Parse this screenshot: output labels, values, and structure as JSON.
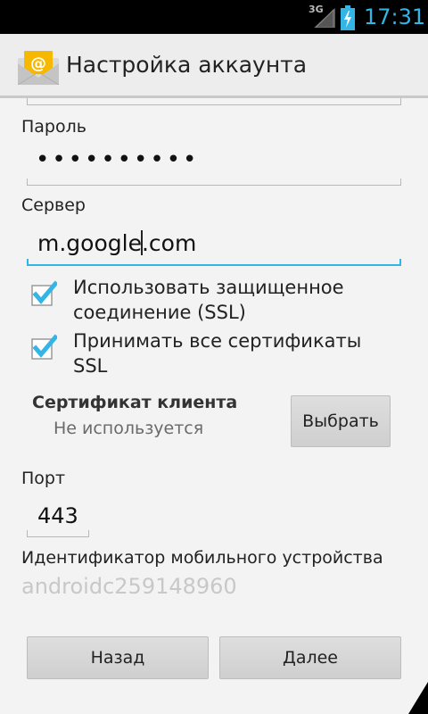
{
  "status_bar": {
    "network": "3G",
    "time": "17:31"
  },
  "action_bar": {
    "title": "Настройка аккаунта",
    "icon": "email-app-icon"
  },
  "form": {
    "password": {
      "label": "Пароль",
      "value": "••••••••••"
    },
    "server": {
      "label": "Сервер",
      "value_before_cursor": "m.google",
      "value_after_cursor": ".com"
    },
    "ssl_checkbox": {
      "label_line1": "Использовать защищенное",
      "label_line2": "соединение (SSL)",
      "checked": true
    },
    "certs_checkbox": {
      "label_line1": "Принимать все сертификаты",
      "label_line2": "SSL",
      "checked": true
    },
    "client_cert": {
      "title": "Сертификат клиента",
      "status": "Не используется",
      "button_label": "Выбрать"
    },
    "port": {
      "label": "Порт",
      "value": "443"
    },
    "device_id": {
      "label": "Идентификатор мобильного устройства",
      "value": "androidc259148960"
    }
  },
  "buttons": {
    "back": "Назад",
    "next": "Далее"
  },
  "colors": {
    "accent": "#33b5e5",
    "background": "#f3f3f3",
    "status_bar": "#000000"
  }
}
